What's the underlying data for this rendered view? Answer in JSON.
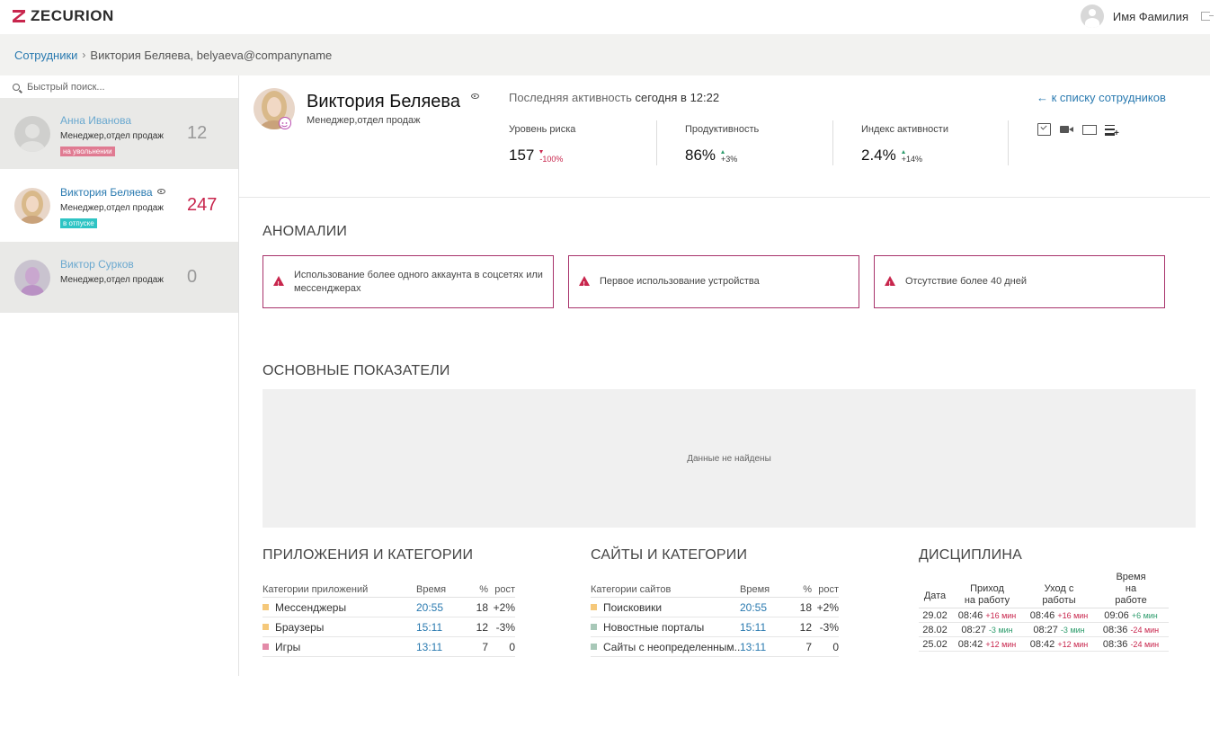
{
  "brand": {
    "name": "ZECURION"
  },
  "user": {
    "name": "Имя Фамилия"
  },
  "breadcrumb": {
    "parent": "Сотрудники",
    "sep": "›",
    "current": "Виктория Беляева, belyaeva@companyname"
  },
  "search": {
    "placeholder": "Быстрый поиск..."
  },
  "employees": [
    {
      "name": "Анна Иванова",
      "role": "Менеджер,отдел продаж",
      "badge": "на увольнении",
      "badge_color": "#e07b92",
      "score": "12",
      "score_color": "#999999",
      "name_color": "#6aa8cf"
    },
    {
      "name": "Виктория Беляева",
      "role": "Менеджер,отдел продаж",
      "badge": "в отпуске",
      "badge_color": "#2ec4c4",
      "score": "247",
      "score_color": "#c8264d",
      "name_color": "#2a7ab0"
    },
    {
      "name": "Виктор Сурков",
      "role": "Менеджер,отдел продаж",
      "badge": "",
      "score": "0",
      "score_color": "#999999",
      "name_color": "#6aa8cf"
    }
  ],
  "profile": {
    "name": "Виктория Беляева",
    "role": "Менеджер,отдел продаж",
    "activity_label": "Последняя активность",
    "activity_time": "сегодня в 12:22",
    "back_link": "← к списку сотрудников",
    "metrics": [
      {
        "label": "Уровень риска",
        "value": "157",
        "delta": "-100%",
        "direction": "down"
      },
      {
        "label": "Продуктивность",
        "value": "86%",
        "delta": "+3%",
        "direction": "up"
      },
      {
        "label": "Индекс активности",
        "value": "2.4%",
        "delta": "+14%",
        "direction": "up-red"
      }
    ]
  },
  "anomalies": {
    "title": "АНОМАЛИИ",
    "items": [
      "Использование более одного аккаунта в соцсетях или мессенджерах",
      "Первое использование устройства",
      "Отсутствие более 40 дней"
    ]
  },
  "main_metrics": {
    "title": "ОСНОВНЫЕ ПОКАЗАТЕЛИ",
    "empty": "Данные не найдены"
  },
  "apps": {
    "title": "ПРИЛОЖЕНИЯ И КАТЕГОРИИ",
    "headers": [
      "Категории приложений",
      "Время",
      "%",
      "рост"
    ],
    "rows": [
      {
        "cat": "Мессенджеры",
        "time": "20:55",
        "pct": "18",
        "grow": "+2%",
        "color": "#f5c87a"
      },
      {
        "cat": "Браузеры",
        "time": "15:11",
        "pct": "12",
        "grow": "-3%",
        "color": "#f5c87a"
      },
      {
        "cat": "Игры",
        "time": "13:11",
        "pct": "7",
        "grow": "0",
        "color": "#e38aa8"
      }
    ]
  },
  "sites": {
    "title": "САЙТЫ И КАТЕГОРИИ",
    "headers": [
      "Категории сайтов",
      "Время",
      "%",
      "рост"
    ],
    "rows": [
      {
        "cat": "Поисковики",
        "time": "20:55",
        "pct": "18",
        "grow": "+2%",
        "color": "#f5c87a"
      },
      {
        "cat": "Новостные порталы",
        "time": "15:11",
        "pct": "12",
        "grow": "-3%",
        "color": "#a8c8b8"
      },
      {
        "cat": "Сайты с неопределенным...",
        "time": "13:11",
        "pct": "7",
        "grow": "0",
        "color": "#a8c8b8"
      }
    ]
  },
  "discipline": {
    "title": "ДИСЦИПЛИНА",
    "headers": [
      "Дата",
      "Приход на работу",
      "Уход с работы",
      "Время на работе"
    ],
    "rows": [
      {
        "date": "29.02",
        "in": "08:46",
        "in_d": "+16 мин",
        "out": "08:46",
        "out_d": "+16 мин",
        "dur": "09:06",
        "dur_d": "+6 мин",
        "dur_sign": "minus"
      },
      {
        "date": "28.02",
        "in": "08:27",
        "in_d": "-3 мин",
        "out": "08:27",
        "out_d": "-3 мин",
        "dur": "08:36",
        "dur_d": "-24 мин",
        "dur_sign": "plus",
        "in_sign": "minus"
      },
      {
        "date": "25.02",
        "in": "08:42",
        "in_d": "+12 мин",
        "out": "08:42",
        "out_d": "+12 мин",
        "dur": "08:36",
        "dur_d": "-24 мин",
        "dur_sign": "plus"
      }
    ]
  }
}
